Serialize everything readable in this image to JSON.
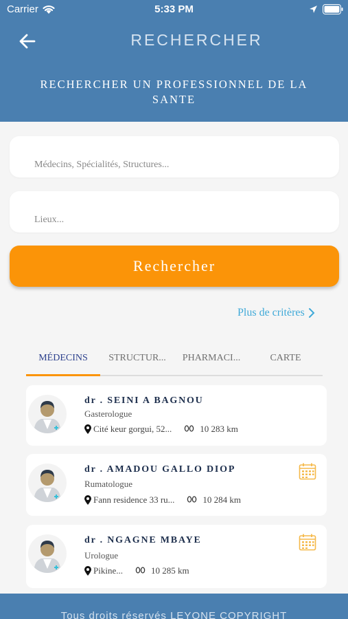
{
  "status_bar": {
    "carrier": "Carrier",
    "time": "5:33 PM"
  },
  "header": {
    "title": "RECHERCHER",
    "subtitle": "RECHERCHER UN PROFESSIONNEL DE LA SANTE",
    "back_icon": "arrow-left-icon"
  },
  "search": {
    "query_placeholder": "Médecins, Spécialités, Structures...",
    "query_value": "",
    "location_placeholder": "Lieux...",
    "location_value": "",
    "button_label": "Rechercher",
    "more_criteria_label": "Plus de critères"
  },
  "tabs": [
    {
      "label": "MÉDECINS",
      "active": true
    },
    {
      "label": "STRUCTUR...",
      "active": false
    },
    {
      "label": "PHARMACI...",
      "active": false
    },
    {
      "label": "CARTE",
      "active": false
    }
  ],
  "doctors": [
    {
      "name": "dr . SEINI A BAGNOU",
      "specialty": "Gasterologue",
      "address": "Cité keur gorgui, 52...",
      "distance": "10 283 km",
      "has_calendar": false
    },
    {
      "name": "dr . AMADOU GALLO DIOP",
      "specialty": "Rumatologue",
      "address": "Fann residence 33 ru...",
      "distance": "10 284 km",
      "has_calendar": true
    },
    {
      "name": "dr . NGAGNE MBAYE",
      "specialty": "Urologue",
      "address": "Pikine...",
      "distance": "10 285 km",
      "has_calendar": true
    }
  ],
  "footer": {
    "text": "Tous droits réservés LEYONE COPYRIGHT"
  },
  "colors": {
    "header_blue": "#4a7fb0",
    "accent_orange": "#fb9408",
    "link_blue": "#3fa9d8",
    "active_tab": "#2b3f8c",
    "calendar_orange": "#f5b94a"
  }
}
